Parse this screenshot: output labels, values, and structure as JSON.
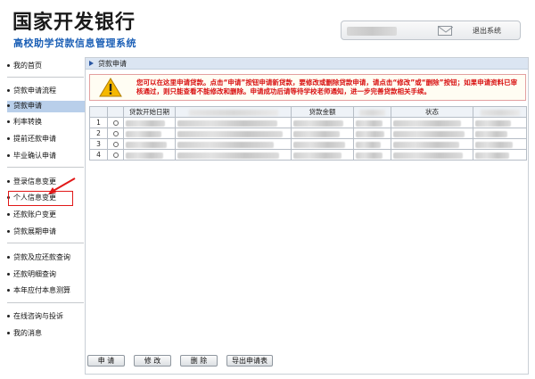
{
  "header": {
    "bank_name": "国家开发银行",
    "system_name": "高校助学贷款信息管理系统",
    "logout_label": "退出系统"
  },
  "sidebar": {
    "items": [
      {
        "label": "我的首页"
      },
      {
        "label": "贷款申请流程"
      },
      {
        "label": "贷款申请"
      },
      {
        "label": "利率转换"
      },
      {
        "label": "提前还款申请"
      },
      {
        "label": "毕业确认申请"
      },
      {
        "label": "登录信息变更"
      },
      {
        "label": "个人信息变更"
      },
      {
        "label": "还款账户变更"
      },
      {
        "label": "贷款展期申请"
      },
      {
        "label": "贷款及应还款查询"
      },
      {
        "label": "还款明细查询"
      },
      {
        "label": "本年应付本息测算"
      },
      {
        "label": "在线咨询与投诉"
      },
      {
        "label": "我的消息"
      }
    ],
    "active_index": 2,
    "highlighted_index": 7
  },
  "panel": {
    "title": "贷款申请",
    "notice": "您可以在这里申请贷款。点击“申请”按钮申请新贷款，要修改或删除贷款申请，请点击“修改”或“删除”按钮；如果申请资料已审核通过，则只能查看不能修改和删除。申请成功后请等待学校老师通知，进一步完善贷款相关手续。"
  },
  "table": {
    "columns": [
      "贷款开始日期",
      "",
      "贷款金额",
      "",
      "状态",
      ""
    ],
    "rows": [
      {
        "index": "1"
      },
      {
        "index": "2"
      },
      {
        "index": "3"
      },
      {
        "index": "4"
      }
    ]
  },
  "buttons": {
    "apply": "申 请",
    "modify": "修 改",
    "delete": "删 除",
    "export": "导出申请表"
  },
  "colors": {
    "brand_blue": "#1b5fb6",
    "notice_red": "#d80f0f",
    "active_bg": "#b9cfea",
    "annotation_red": "#e11818"
  },
  "icons": {
    "mail": "mail-icon",
    "warning": "warning-icon",
    "panel_marker": "triangle-right-icon"
  }
}
